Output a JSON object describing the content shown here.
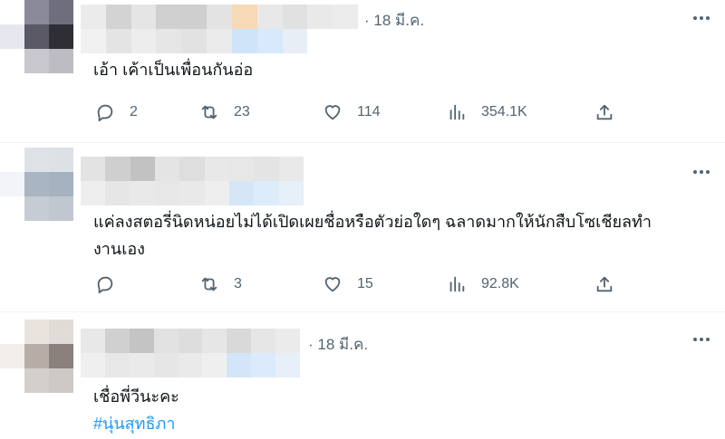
{
  "tweets": [
    {
      "date": "· 18 มี.ค.",
      "text_lines": [
        "เอ้า เค้าเป็นเพื่อนกันอ่อ"
      ],
      "hashtag": "",
      "replies": "2",
      "retweets": "23",
      "likes": "114",
      "views": "354.1K"
    },
    {
      "date": "",
      "text_lines": [
        "แค่ลงสตอรี่นิดหน่อยไม่ได้เปิดเผยชื่อหรือตัวย่อใดๆ ฉลาดมากให้นักสืบโซเชียลทำ",
        "งานเอง"
      ],
      "hashtag": "",
      "replies": "",
      "retweets": "3",
      "likes": "15",
      "views": "92.8K"
    },
    {
      "date": "· 18 มี.ค.",
      "text_lines": [
        "เชื่อพี่วีนะคะ"
      ],
      "hashtag": "#นุ่นสุทธิภา",
      "replies": "",
      "retweets": "",
      "likes": "",
      "views": ""
    }
  ],
  "icons": {
    "reply": "reply-icon",
    "retweet": "retweet-icon",
    "like": "like-icon",
    "views": "views-icon",
    "share": "share-icon",
    "more": "more-icon"
  },
  "colors": {
    "text": "#0f1419",
    "secondary": "#536471",
    "hashtag": "#1d9bf0",
    "divider": "#eff3f4"
  }
}
